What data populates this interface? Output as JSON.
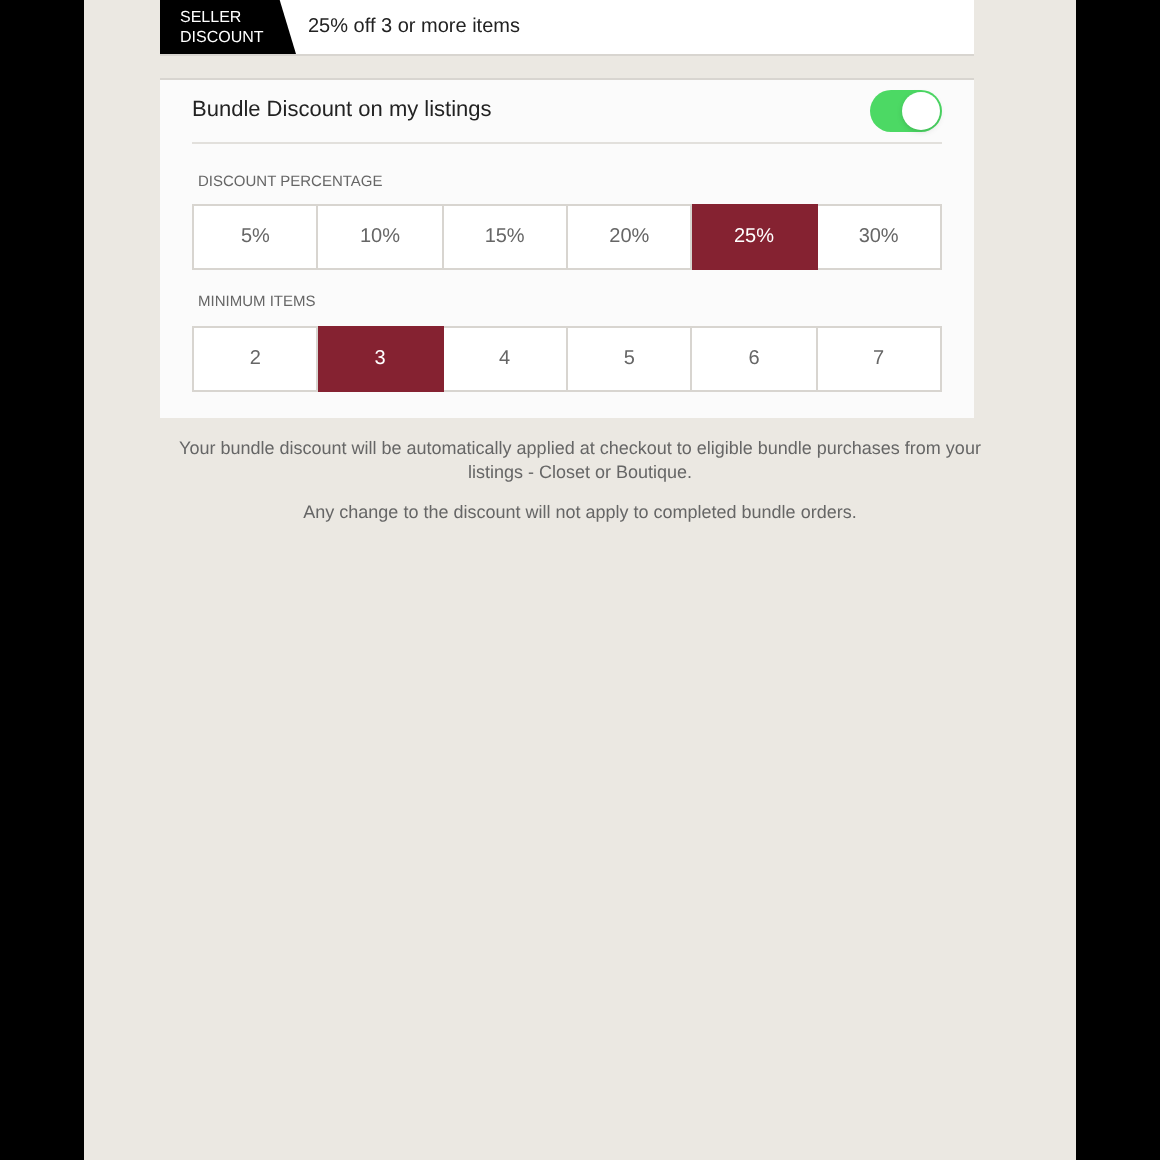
{
  "banner": {
    "badge": "SELLER\nDISCOUNT",
    "text": "25% off 3 or more items"
  },
  "bundle": {
    "label": "Bundle Discount on my listings",
    "on": true
  },
  "groups": [
    {
      "heading": "DISCOUNT PERCENTAGE",
      "options": [
        {
          "label": "5%",
          "selected": false
        },
        {
          "label": "10%",
          "selected": false
        },
        {
          "label": "15%",
          "selected": false
        },
        {
          "label": "20%",
          "selected": false
        },
        {
          "label": "25%",
          "selected": true
        },
        {
          "label": "30%",
          "selected": false
        }
      ]
    },
    {
      "heading": "MINIMUM ITEMS",
      "options": [
        {
          "label": "2",
          "selected": false
        },
        {
          "label": "3",
          "selected": true
        },
        {
          "label": "4",
          "selected": false
        },
        {
          "label": "5",
          "selected": false
        },
        {
          "label": "6",
          "selected": false
        },
        {
          "label": "7",
          "selected": false
        }
      ]
    }
  ],
  "notes": [
    "Your bundle discount will be automatically applied at checkout to eligible bundle purchases from your listings - Closet or Boutique.",
    "Any change to the discount will not apply to completed bundle orders."
  ]
}
